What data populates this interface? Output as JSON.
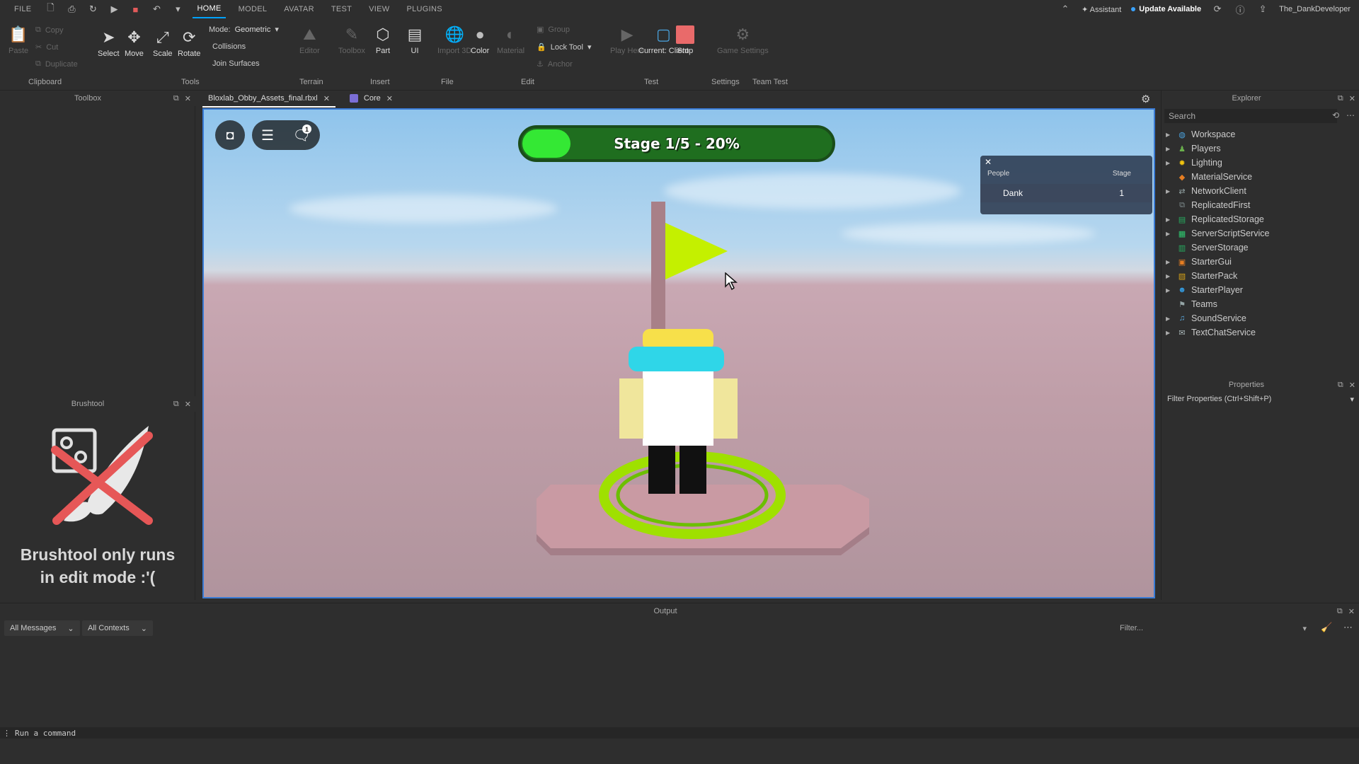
{
  "menubar": {
    "file": "FILE",
    "tabs": [
      {
        "label": "HOME",
        "active": true
      },
      {
        "label": "MODEL",
        "active": false
      },
      {
        "label": "AVATAR",
        "active": false
      },
      {
        "label": "TEST",
        "active": false
      },
      {
        "label": "VIEW",
        "active": false
      },
      {
        "label": "PLUGINS",
        "active": false
      }
    ],
    "assistant": "Assistant",
    "update": "Update Available",
    "user": "The_DankDeveloper"
  },
  "ribbon": {
    "clipboard": {
      "paste": "Paste",
      "copy": "Copy",
      "cut": "Cut",
      "duplicate": "Duplicate",
      "label": "Clipboard"
    },
    "tools": {
      "select": "Select",
      "move": "Move",
      "scale": "Scale",
      "rotate": "Rotate",
      "mode_label": "Mode:",
      "mode_value": "Geometric",
      "collisions": "Collisions",
      "join_surfaces": "Join Surfaces",
      "label": "Tools"
    },
    "terrain": {
      "editor": "Editor",
      "label": "Terrain"
    },
    "insert": {
      "toolbox": "Toolbox",
      "part": "Part",
      "ui": "UI",
      "label": "Insert"
    },
    "file": {
      "import3d": "Import 3D",
      "label": "File"
    },
    "edit": {
      "color": "Color",
      "material": "Material",
      "group": "Group",
      "lock_tool": "Lock Tool",
      "anchor": "Anchor",
      "label": "Edit"
    },
    "test": {
      "play_here": "Play Here",
      "current_client": "Current: Client",
      "stop": "Stop",
      "label": "Test"
    },
    "settings": {
      "game_settings": "Game Settings",
      "label": "Settings"
    },
    "team_test": {
      "label": "Team Test"
    }
  },
  "toolbox": {
    "title": "Toolbox"
  },
  "brushtool": {
    "title": "Brushtool",
    "message_line1": "Brushtool only runs",
    "message_line2": "in edit mode :'("
  },
  "tabs": [
    {
      "label": "Bloxlab_Obby_Assets_final.rbxl",
      "active": true
    },
    {
      "label": "Core",
      "active": false
    }
  ],
  "viewport": {
    "stage_text": "Stage 1/5 - 20%",
    "stage_progress": 0.2,
    "leaderboard": {
      "col_people": "People",
      "col_stage": "Stage",
      "rows": [
        {
          "name": "Dank",
          "stage": "1"
        }
      ]
    },
    "chat_badge": "1"
  },
  "explorer": {
    "title": "Explorer",
    "search_placeholder": "Search",
    "items": [
      {
        "label": "Workspace",
        "icon": "globe-icon",
        "color": "#4aa3df"
      },
      {
        "label": "Players",
        "icon": "players-icon",
        "color": "#6ab04c"
      },
      {
        "label": "Lighting",
        "icon": "bulb-icon",
        "color": "#f1c40f"
      },
      {
        "label": "MaterialService",
        "icon": "material-icon",
        "color": "#e67e22"
      },
      {
        "label": "NetworkClient",
        "icon": "network-icon",
        "color": "#95a5a6"
      },
      {
        "label": "ReplicatedFirst",
        "icon": "replicated-first-icon",
        "color": "#7f8c8d"
      },
      {
        "label": "ReplicatedStorage",
        "icon": "replicated-storage-icon",
        "color": "#27ae60"
      },
      {
        "label": "ServerScriptService",
        "icon": "server-script-icon",
        "color": "#2ecc71"
      },
      {
        "label": "ServerStorage",
        "icon": "server-storage-icon",
        "color": "#27ae60"
      },
      {
        "label": "StarterGui",
        "icon": "starter-gui-icon",
        "color": "#e67e22"
      },
      {
        "label": "StarterPack",
        "icon": "starter-pack-icon",
        "color": "#d4a017"
      },
      {
        "label": "StarterPlayer",
        "icon": "starter-player-icon",
        "color": "#3498db"
      },
      {
        "label": "Teams",
        "icon": "teams-icon",
        "color": "#95a5a6"
      },
      {
        "label": "SoundService",
        "icon": "sound-icon",
        "color": "#5dade2"
      },
      {
        "label": "TextChatService",
        "icon": "text-chat-icon",
        "color": "#aab7b8"
      }
    ]
  },
  "properties": {
    "title": "Properties",
    "filter_placeholder": "Filter Properties (Ctrl+Shift+P)"
  },
  "output": {
    "title": "Output",
    "messages_filter": "All Messages",
    "contexts_filter": "All Contexts",
    "filter_placeholder": "Filter..."
  },
  "command": {
    "placeholder": "Run a command"
  }
}
